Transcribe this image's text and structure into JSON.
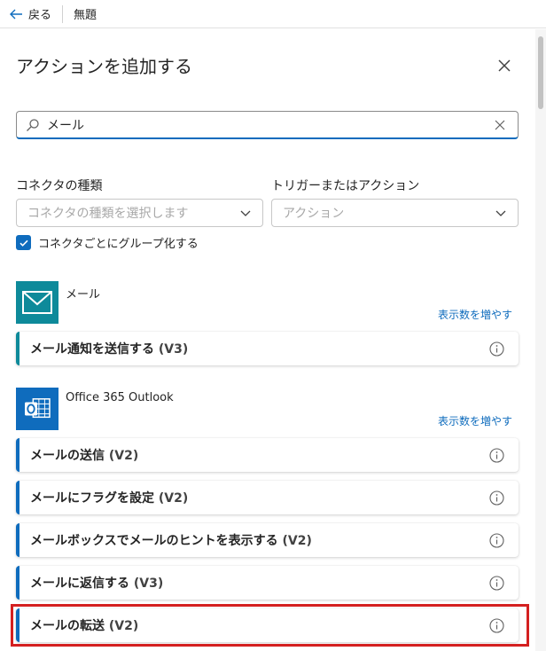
{
  "topbar": {
    "back_label": "戻る",
    "flow_title": "無題"
  },
  "panel": {
    "title": "アクションを追加する",
    "search": {
      "value": "メール",
      "placeholder": ""
    }
  },
  "filters": {
    "connector_type_label": "コネクタの種類",
    "connector_type_placeholder": "コネクタの種類を選択します",
    "trigger_action_label": "トリガーまたはアクション",
    "trigger_action_placeholder": "アクション",
    "group_by_connector_label": "コネクタごとにグループ化する",
    "group_by_connector_checked": true
  },
  "connectors": [
    {
      "name": "メール",
      "more_label": "表示数を増やす",
      "icon": "mail-envelope-icon",
      "color": "#0e8a9a",
      "actions": [
        {
          "label": "メール通知を送信する",
          "version": "(V3)"
        }
      ]
    },
    {
      "name": "Office 365 Outlook",
      "more_label": "表示数を増やす",
      "icon": "outlook-icon",
      "color": "#0f6cbd",
      "actions": [
        {
          "label": "メールの送信",
          "version": "(V2)"
        },
        {
          "label": "メールにフラグを設定",
          "version": "(V2)"
        },
        {
          "label": "メールボックスでメールのヒントを表示する",
          "version": "(V2)"
        },
        {
          "label": "メールに返信する",
          "version": "(V3)"
        },
        {
          "label": "メールの転送",
          "version": "(V2)"
        }
      ]
    }
  ],
  "colors": {
    "accent": "#0f6cbd",
    "highlight": "#d42020",
    "mail_connector": "#0e8a9a"
  }
}
